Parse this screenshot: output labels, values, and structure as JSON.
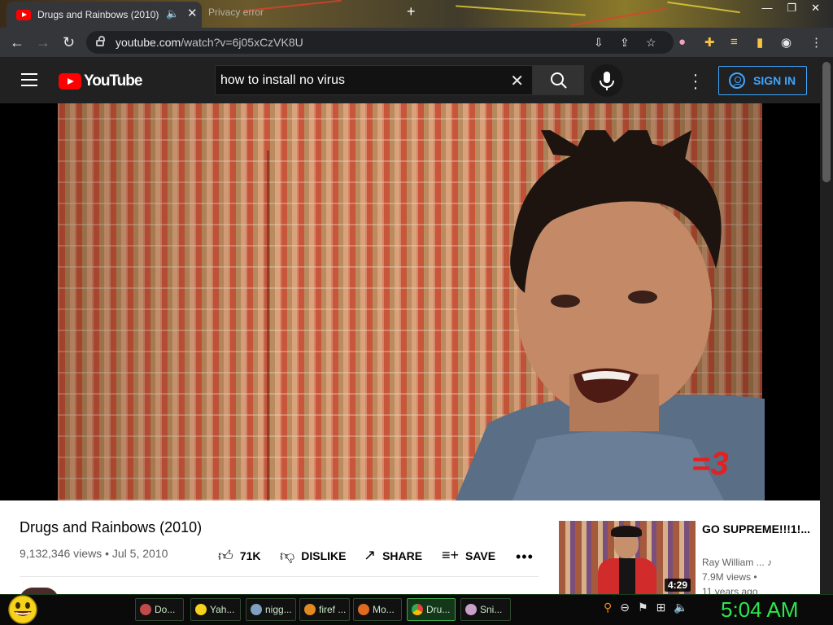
{
  "browser": {
    "tabs": [
      {
        "title": "Drugs and Rainbows (2010)",
        "active": true
      },
      {
        "title": "Privacy error",
        "active": false
      }
    ],
    "url_host": "youtube.com",
    "url_path": "/watch?v=6j05xCzVK8U"
  },
  "youtube": {
    "logo_text": "YouTube",
    "search_value": "how to install no virus",
    "sign_in_label": "SIGN IN"
  },
  "video": {
    "overlay_text": "=3",
    "title": "Drugs and Rainbows (2010)",
    "views": "9,132,346 views",
    "date": "Jul 5, 2010",
    "likes": "71K",
    "dislike_label": "DISLIKE",
    "share_label": "SHARE",
    "save_label": "SAVE"
  },
  "related": {
    "title": "GO SUPREME!!!1!...",
    "channel": "Ray William ...",
    "views": "7.9M views",
    "age": "11 years ago",
    "duration": "4:29"
  },
  "taskbar": {
    "tasks": [
      "Do...",
      "Yah...",
      "nigg...",
      "firef ...",
      "Mo...",
      "Dru...",
      "Sni..."
    ],
    "active_task_index": 5,
    "clock": "5:04 AM"
  }
}
